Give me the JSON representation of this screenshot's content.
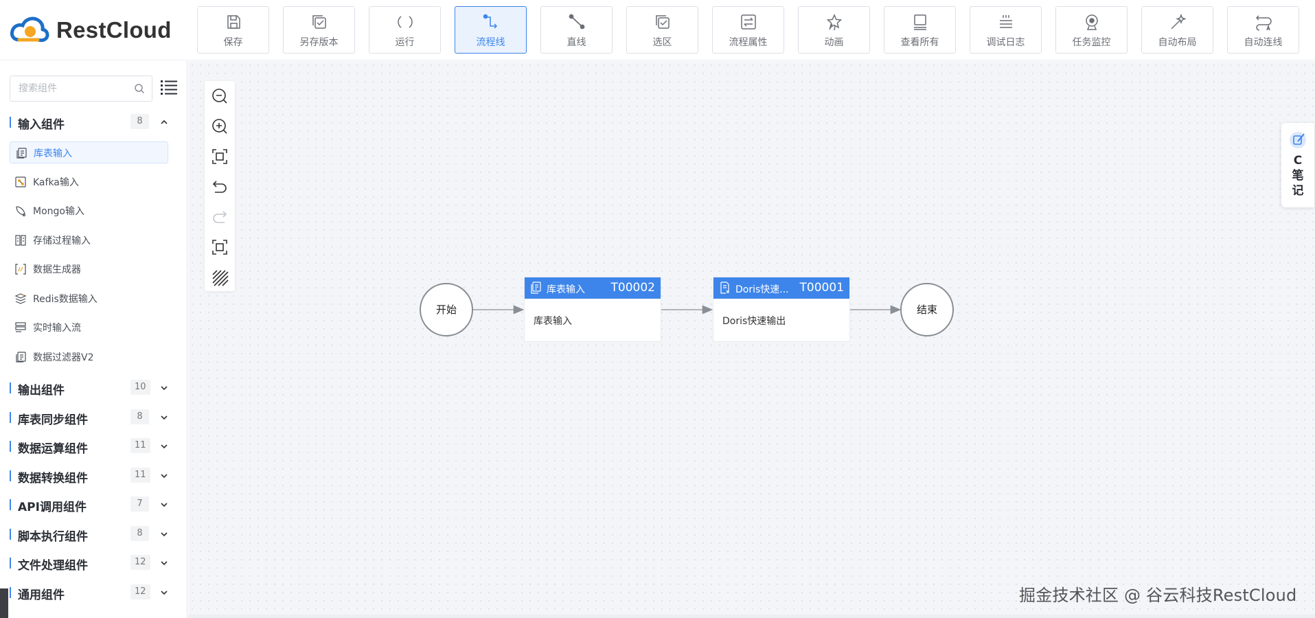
{
  "app": {
    "brand": "RestCloud",
    "brand_color": "#3d85ea"
  },
  "toolbar": [
    {
      "label": "保存",
      "icon": "save-icon"
    },
    {
      "label": "另存版本",
      "icon": "save-version-icon"
    },
    {
      "label": "运行",
      "icon": "run-icon"
    },
    {
      "label": "流程线",
      "icon": "flow-line-icon",
      "active": true
    },
    {
      "label": "直线",
      "icon": "straight-line-icon"
    },
    {
      "label": "选区",
      "icon": "selection-icon"
    },
    {
      "label": "流程属性",
      "icon": "flow-properties-icon"
    },
    {
      "label": "动画",
      "icon": "animation-icon"
    },
    {
      "label": "查看所有",
      "icon": "view-all-icon"
    },
    {
      "label": "调试日志",
      "icon": "debug-log-icon"
    },
    {
      "label": "任务监控",
      "icon": "task-monitor-icon"
    },
    {
      "label": "自动布局",
      "icon": "auto-layout-icon"
    },
    {
      "label": "自动连线",
      "icon": "auto-connect-icon"
    }
  ],
  "sidebar": {
    "search_placeholder": "搜索组件",
    "expanded_category": {
      "label": "输入组件",
      "count": "8",
      "items": [
        {
          "label": "库表输入",
          "icon": "db-table-input-icon",
          "selected": true
        },
        {
          "label": "Kafka输入",
          "icon": "kafka-input-icon"
        },
        {
          "label": "Mongo输入",
          "icon": "mongo-input-icon"
        },
        {
          "label": "存储过程输入",
          "icon": "stored-procedure-input-icon"
        },
        {
          "label": "数据生成器",
          "icon": "data-generator-icon"
        },
        {
          "label": "Redis数据输入",
          "icon": "redis-input-icon"
        },
        {
          "label": "实时输入流",
          "icon": "realtime-stream-icon"
        },
        {
          "label": "数据过滤器V2",
          "icon": "data-filter-icon"
        }
      ]
    },
    "categories": [
      {
        "label": "输出组件",
        "count": "10"
      },
      {
        "label": "库表同步组件",
        "count": "8"
      },
      {
        "label": "数据运算组件",
        "count": "11"
      },
      {
        "label": "数据转换组件",
        "count": "11"
      },
      {
        "label": "API调用组件",
        "count": "7"
      },
      {
        "label": "脚本执行组件",
        "count": "8"
      },
      {
        "label": "文件处理组件",
        "count": "12"
      },
      {
        "label": "通用组件",
        "count": "12"
      }
    ]
  },
  "canvas_tools": [
    "zoom-out-icon",
    "zoom-in-icon",
    "fit-view-icon",
    "undo-icon",
    "redo-icon",
    "actual-size-icon",
    "grid-toggle-icon"
  ],
  "flow": {
    "start_label": "开始",
    "end_label": "结束",
    "tasks": [
      {
        "name": "库表输入",
        "code": "T00002",
        "desc": "库表输入"
      },
      {
        "name": "Doris快速...",
        "code": "T00001",
        "desc": "Doris快速输出"
      }
    ]
  },
  "note_widget": {
    "line1": "C",
    "line2": "笔",
    "line3": "记"
  },
  "watermark": "掘金技术社区 @ 谷云科技RestCloud"
}
